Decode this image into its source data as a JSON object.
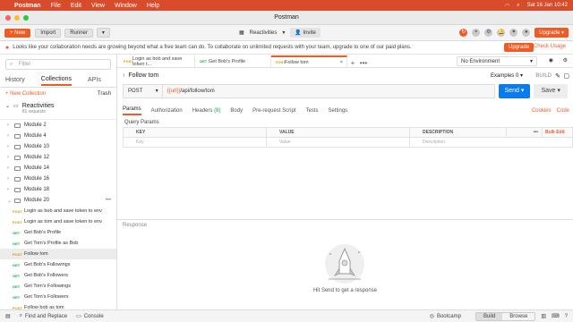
{
  "menubar": {
    "app": "Postman",
    "items": [
      "File",
      "Edit",
      "View",
      "Window",
      "Help"
    ],
    "datetime": "Sat 16 Jan 10:42"
  },
  "window": {
    "title": "Postman"
  },
  "toolbar": {
    "new_label": "New",
    "import_label": "Import",
    "runner_label": "Runner",
    "workspace": "Reactivities",
    "invite_label": "Invite",
    "upgrade_label": "Upgrade"
  },
  "notice": {
    "text": "Looks like your collaboration needs are growing beyond what a free team can do. To collaborate on unlimited requests with your team, upgrade to one of our paid plans.",
    "upgrade_label": "Upgrade",
    "check_label": "Check Usage"
  },
  "sidebar": {
    "filter_placeholder": "Filter",
    "tabs": [
      "History",
      "Collections",
      "APIs"
    ],
    "new_collection": "+ New Collection",
    "trash": "Trash",
    "collection": {
      "name": "Reactivities",
      "count": "81 requests"
    },
    "folders": [
      "Module 2",
      "Module 4",
      "Module 10",
      "Module 12",
      "Module 14",
      "Module 16",
      "Module 18",
      "Module 20"
    ],
    "requests": [
      {
        "method": "POST",
        "name": "Login as bob and save token to env"
      },
      {
        "method": "POST",
        "name": "Login as tom and save token to env"
      },
      {
        "method": "GET",
        "name": "Get Bob's Profile"
      },
      {
        "method": "GET",
        "name": "Get Tom's Profile as Bob"
      },
      {
        "method": "POST",
        "name": "Follow tom"
      },
      {
        "method": "GET",
        "name": "Get Bob's Followings"
      },
      {
        "method": "GET",
        "name": "Get Bob's Followers"
      },
      {
        "method": "GET",
        "name": "Get Tom's Followings"
      },
      {
        "method": "GET",
        "name": "Get Tom's Followers"
      },
      {
        "method": "POST",
        "name": "Follow bob as tom"
      }
    ]
  },
  "tabs": [
    {
      "method": "POST",
      "name": "Login as bob and save token t..."
    },
    {
      "method": "GET",
      "name": "Get Bob's Profile"
    },
    {
      "method": "POST",
      "name": "Follow tom"
    }
  ],
  "environment": "No Environment",
  "request": {
    "title": "Follow tom",
    "examples_label": "Examples",
    "examples_count": "0",
    "build_label": "BUILD",
    "method": "POST",
    "url_var": "{{url}}",
    "url_rest": "/api/follow/tom",
    "send_label": "Send",
    "save_label": "Save",
    "tabs": [
      "Params",
      "Authorization",
      "Headers",
      "Body",
      "Pre-request Script",
      "Tests",
      "Settings"
    ],
    "headers_count": "(8)",
    "cookies_label": "Cookies",
    "code_label": "Code",
    "query_params_label": "Query Params",
    "table_headers": [
      "KEY",
      "VALUE",
      "DESCRIPTION"
    ],
    "bulk_edit": "Bulk Edit",
    "placeholders": [
      "Key",
      "Value",
      "Description"
    ]
  },
  "response": {
    "label": "Response",
    "hint": "Hit Send to get a response"
  },
  "statusbar": {
    "find_replace": "Find and Replace",
    "console": "Console",
    "bootcamp": "Bootcamp",
    "build": "Build",
    "browse": "Browse"
  },
  "colors": {
    "accent": "#ef5b25",
    "send": "#097bed",
    "get": "#0cb14b",
    "post": "#d89a06",
    "menubar": "#d94c2b"
  }
}
